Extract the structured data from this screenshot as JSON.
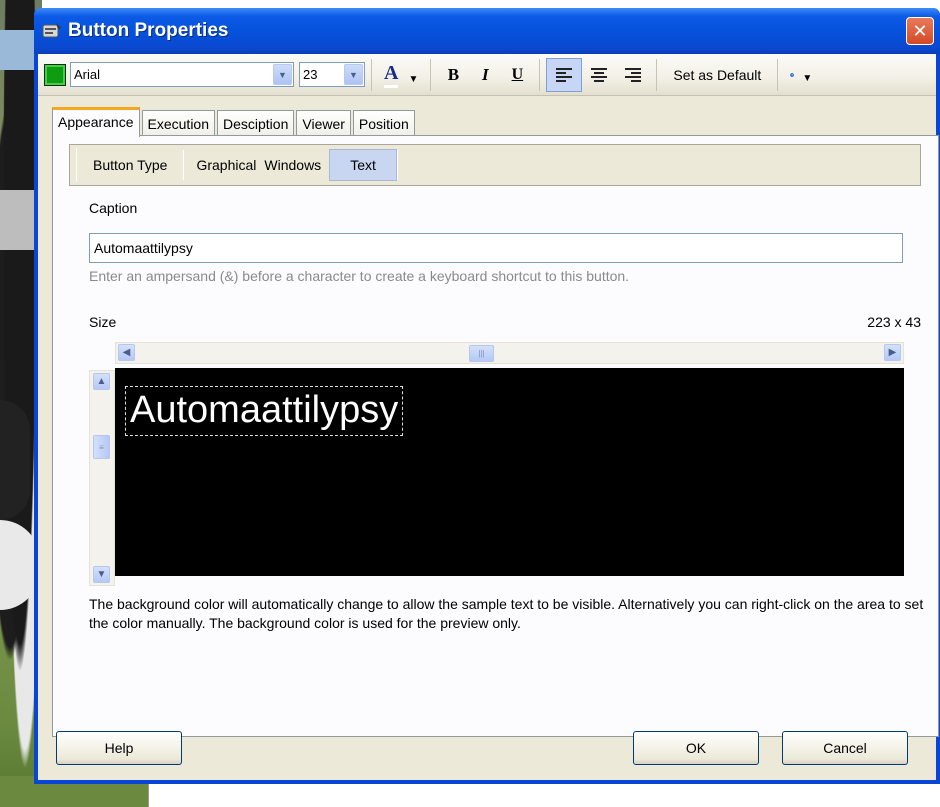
{
  "window": {
    "title": "Button Properties"
  },
  "toolbar": {
    "font_name": "Arial",
    "font_size": "23",
    "color_swatch": "#0f9b12",
    "font_color_label": "A",
    "bold_label": "B",
    "italic_label": "I",
    "underline_label": "U",
    "set_default_label": "Set as Default"
  },
  "tabs": [
    {
      "label": "Appearance",
      "active": true
    },
    {
      "label": "Execution"
    },
    {
      "label": "Desciption"
    },
    {
      "label": "Viewer"
    },
    {
      "label": "Position"
    }
  ],
  "button_type": {
    "label": "Button Type",
    "options": [
      "Graphical",
      "Windows",
      "Text"
    ],
    "selected": "Text"
  },
  "caption": {
    "label": "Caption",
    "value": "Automaattilypsy",
    "hint": "Enter an ampersand (&) before a character to create a keyboard shortcut to this button."
  },
  "size": {
    "label": "Size",
    "value": "223 x 43"
  },
  "preview": {
    "text": "Automaattilypsy",
    "background": "#000000"
  },
  "note": "The background color will automatically change to allow the sample text to be visible. Alternatively you can right-click on the area to set the color manually. The background color is used for the preview only.",
  "footer": {
    "help_label": "Help",
    "ok_label": "OK",
    "cancel_label": "Cancel"
  }
}
